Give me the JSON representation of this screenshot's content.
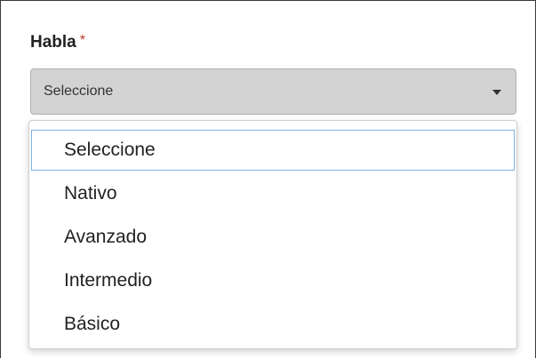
{
  "field": {
    "label": "Habla",
    "required_mark": "*",
    "selected_value": "Seleccione"
  },
  "dropdown": {
    "options": [
      {
        "label": "Seleccione",
        "highlighted": true
      },
      {
        "label": "Nativo",
        "highlighted": false
      },
      {
        "label": "Avanzado",
        "highlighted": false
      },
      {
        "label": "Intermedio",
        "highlighted": false
      },
      {
        "label": "Básico",
        "highlighted": false
      }
    ]
  },
  "colors": {
    "required": "#c0392b",
    "select_background": "#d3d3d3",
    "highlight_border": "#7fb0e6"
  }
}
